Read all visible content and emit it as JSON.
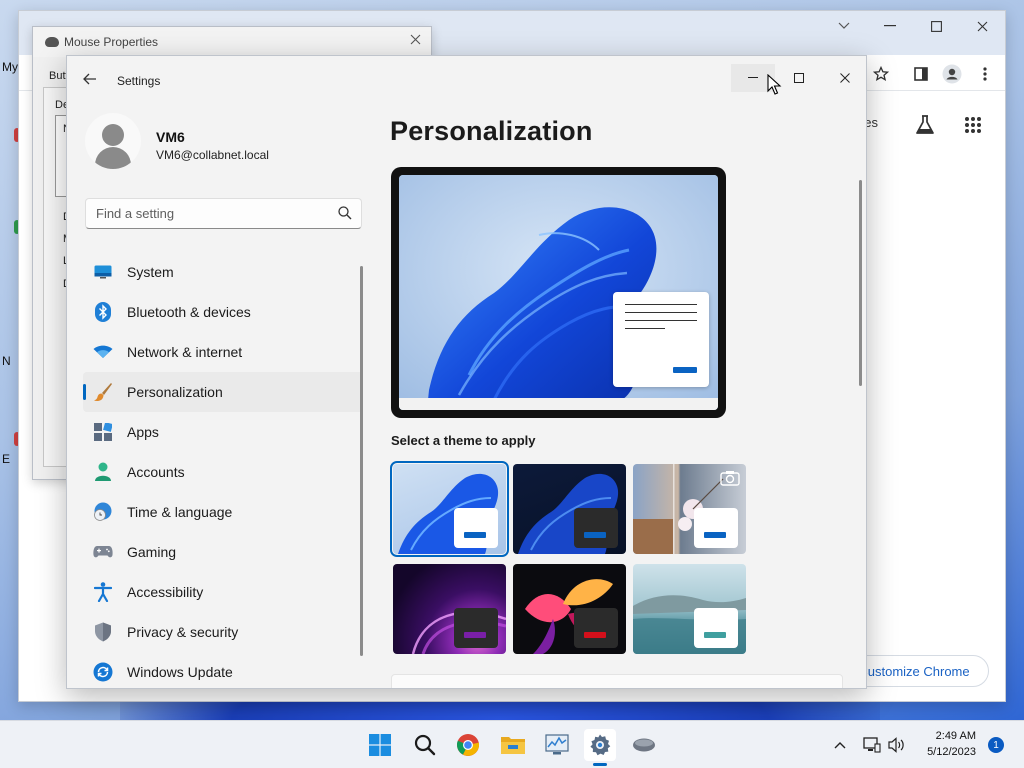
{
  "desktop": {
    "label_1": "My",
    "label_2": "N",
    "label_3": "E"
  },
  "chrome": {
    "ntp_text_fragment": "ges",
    "customize_label": "Customize Chrome",
    "icons": [
      "chevron-down-icon",
      "minimize-icon",
      "maximize-icon",
      "close-icon",
      "star-icon",
      "side-panel-icon",
      "profile-icon",
      "more-vert-icon",
      "labs-flask-icon",
      "apps-grid-icon"
    ]
  },
  "mouse_properties": {
    "title": "Mouse Properties",
    "frag_tab": "Butt",
    "frag_1": "De",
    "frag_2": "N",
    "frag_3": "D",
    "frag_4": "M",
    "frag_5": "L",
    "frag_6": "D"
  },
  "settings": {
    "app_title": "Settings",
    "user": {
      "name": "VM6",
      "email": "VM6@collabnet.local"
    },
    "search": {
      "placeholder": "Find a setting"
    },
    "nav": [
      {
        "label": "System",
        "icon": "system-icon",
        "active": false
      },
      {
        "label": "Bluetooth & devices",
        "icon": "bluetooth-icon",
        "active": false
      },
      {
        "label": "Network & internet",
        "icon": "wifi-icon",
        "active": false
      },
      {
        "label": "Personalization",
        "icon": "paintbrush-icon",
        "active": true
      },
      {
        "label": "Apps",
        "icon": "apps-icon",
        "active": false
      },
      {
        "label": "Accounts",
        "icon": "accounts-icon",
        "active": false
      },
      {
        "label": "Time & language",
        "icon": "time-language-icon",
        "active": false
      },
      {
        "label": "Gaming",
        "icon": "gamepad-icon",
        "active": false
      },
      {
        "label": "Accessibility",
        "icon": "accessibility-icon",
        "active": false
      },
      {
        "label": "Privacy & security",
        "icon": "shield-icon",
        "active": false
      },
      {
        "label": "Windows Update",
        "icon": "windows-update-icon",
        "active": false
      }
    ],
    "page_title": "Personalization",
    "themes_heading": "Select a theme to apply",
    "themes": [
      {
        "name": "windows-light",
        "selected": true,
        "accent": "#0a63c2"
      },
      {
        "name": "windows-dark",
        "selected": false,
        "accent": "#0a63c2"
      },
      {
        "name": "windows-spotlight",
        "selected": false,
        "accent": "#0a63c2"
      },
      {
        "name": "glow",
        "selected": false,
        "accent": "#7a1fa8"
      },
      {
        "name": "captured-motion",
        "selected": false,
        "accent": "#d4101b"
      },
      {
        "name": "flow",
        "selected": false,
        "accent": "#3f9f9f"
      }
    ],
    "accent_color": "#0067c0"
  },
  "taskbar": {
    "apps": [
      "windows-start-icon",
      "search-icon",
      "chrome-icon",
      "file-explorer-icon",
      "performance-monitor-icon",
      "settings-gear-icon",
      "mouse-icon"
    ],
    "time": "2:49 AM",
    "date": "5/12/2023",
    "notification_count": "1"
  }
}
